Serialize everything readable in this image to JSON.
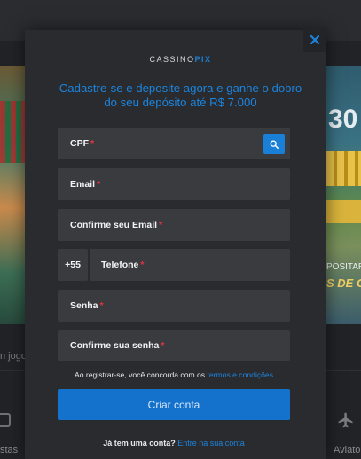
{
  "logo": {
    "part1": "CASSINO",
    "part2": "PIX"
  },
  "headline": "Cadastre-se e deposite agora e ganhe o dobro do seu depósito até R$ 7.000",
  "fields": {
    "cpf": {
      "label": "CPF",
      "required": "*"
    },
    "email": {
      "label": "Email",
      "required": "*"
    },
    "email_confirm": {
      "label": "Confirme seu Email",
      "required": "*"
    },
    "phone_prefix": "+55",
    "phone": {
      "label": "Telefone",
      "required": "*"
    },
    "password": {
      "label": "Senha",
      "required": "*"
    },
    "password_confirm": {
      "label": "Confirme sua senha",
      "required": "*"
    }
  },
  "terms": {
    "text": "Ao registrar-se, você concorda com os",
    "link": "termos e condições"
  },
  "submit_label": "Criar conta",
  "login": {
    "question": "Já tem uma conta?",
    "link": "Entre na sua conta"
  },
  "close_label": "✕",
  "background": {
    "banner_right_big": "30",
    "banner_right_dep": "POSITAR",
    "banner_right_gold": "S DE G",
    "jogo_text": "n jogo",
    "category_left_label": "stas",
    "category_right_label": "Aviato"
  },
  "colors": {
    "accent": "#1a7fd6",
    "required": "#e4333e",
    "modal_bg": "#2a2b2e",
    "field_bg": "#3a3b3f"
  },
  "icons": {
    "search": "search-icon",
    "close": "close-icon"
  }
}
